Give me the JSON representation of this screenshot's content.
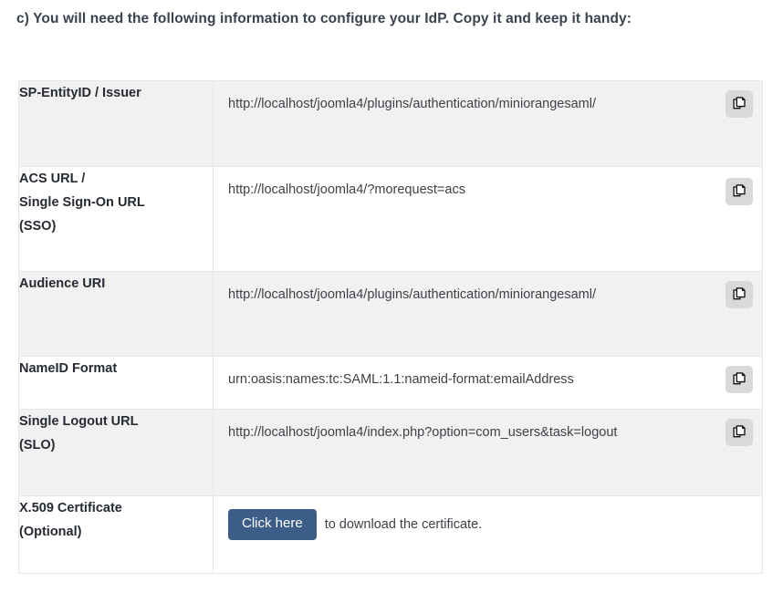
{
  "heading": "c) You will need the following information to configure your IdP. Copy it and keep it handy:",
  "colors": {
    "button_primary": "#3b5d87",
    "row_shaded": "#f1f1f1",
    "row_plain": "#ffffff",
    "heading_text": "#3b4250",
    "copy_button_bg": "#d9d9d9"
  },
  "table": {
    "rows": [
      {
        "label": "SP-EntityID / Issuer",
        "value": "http://localhost/joomla4/plugins/authentication/miniorangesaml/",
        "copy_icon": "copy-icon"
      },
      {
        "label": "ACS URL /\nSingle Sign-On URL\n(SSO)",
        "label_lines": [
          "ACS URL /",
          "Single Sign-On URL",
          "(SSO)"
        ],
        "value": "http://localhost/joomla4/?morequest=acs",
        "copy_icon": "copy-icon"
      },
      {
        "label": "Audience URI",
        "value": "http://localhost/joomla4/plugins/authentication/miniorangesaml/",
        "copy_icon": "copy-icon"
      },
      {
        "label": "NameID Format",
        "value": "urn:oasis:names:tc:SAML:1.1:nameid-format:emailAddress",
        "copy_icon": "copy-icon"
      },
      {
        "label": "Single Logout URL\n(SLO)",
        "label_lines": [
          "Single Logout URL",
          "(SLO)"
        ],
        "value": "http://localhost/joomla4/index.php?option=com_users&task=logout",
        "copy_icon": "copy-icon"
      },
      {
        "label": "X.509 Certificate\n(Optional)",
        "label_lines": [
          "X.509 Certificate",
          "(Optional)"
        ],
        "button_label": "Click here",
        "note": "to download the certificate."
      }
    ]
  }
}
